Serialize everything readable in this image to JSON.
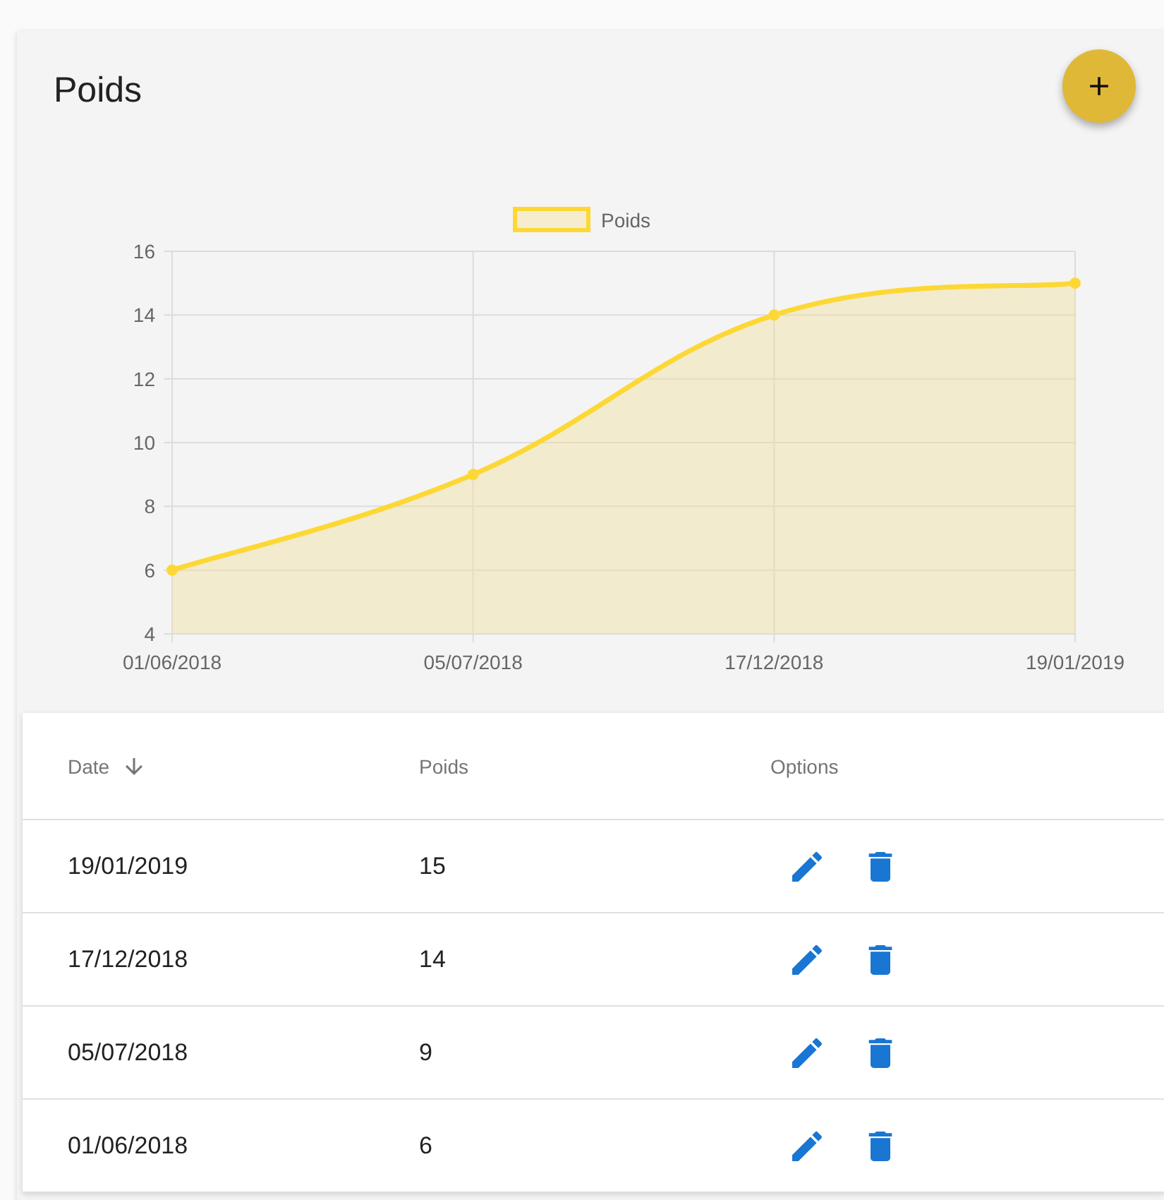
{
  "title": "Poids",
  "chart_data": {
    "type": "area",
    "categories": [
      "01/06/2018",
      "05/07/2018",
      "17/12/2018",
      "19/01/2019"
    ],
    "series": [
      {
        "name": "Poids",
        "color": "#fdd835",
        "values": [
          6,
          9,
          14,
          15
        ]
      }
    ],
    "ylim": [
      4,
      16
    ],
    "grid": true,
    "yticks": [
      4,
      6,
      8,
      10,
      12,
      14,
      16
    ]
  },
  "table": {
    "columns": [
      {
        "label": "Date",
        "sorted": true
      },
      {
        "label": "Poids",
        "sorted": false
      },
      {
        "label": "Options",
        "sorted": false
      }
    ],
    "rows": [
      {
        "date": "19/01/2019",
        "poids": "15"
      },
      {
        "date": "17/12/2018",
        "poids": "14"
      },
      {
        "date": "05/07/2018",
        "poids": "9"
      },
      {
        "date": "01/06/2018",
        "poids": "6"
      }
    ]
  }
}
